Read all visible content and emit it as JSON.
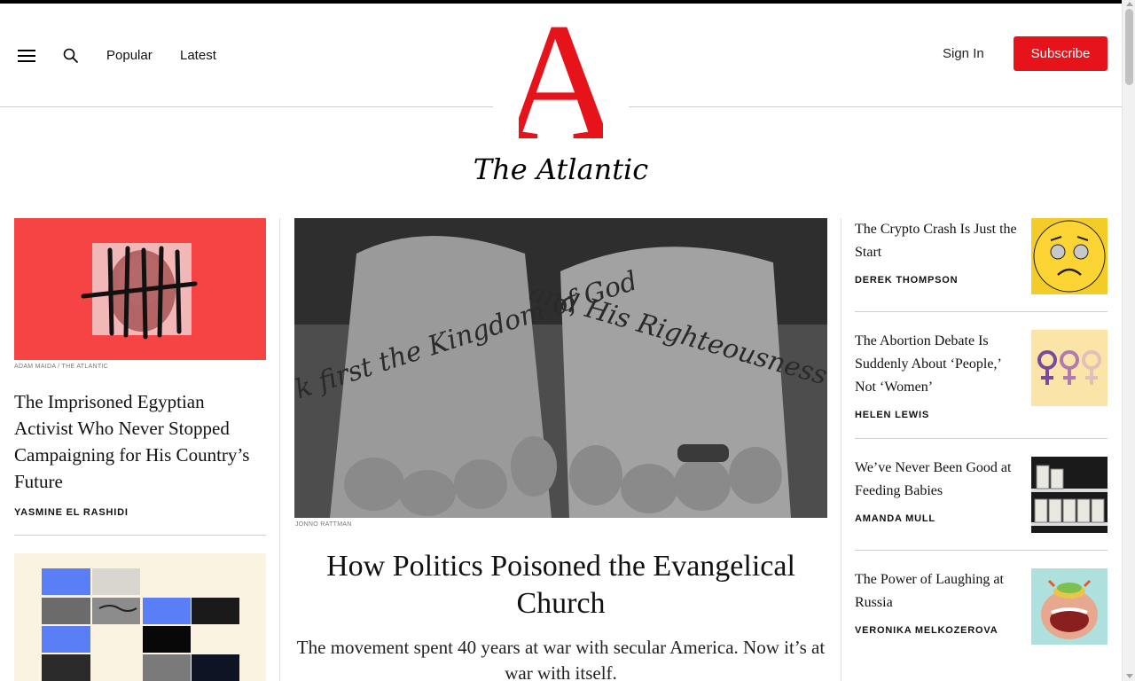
{
  "nav": {
    "popular": "Popular",
    "latest": "Latest",
    "sign_in": "Sign In",
    "subscribe": "Subscribe"
  },
  "brand": {
    "logo_letter": "A",
    "wordmark": "The Atlantic",
    "accent_color": "#e7131a"
  },
  "left": {
    "story1": {
      "credit": "ADAM MAIDA / THE ATLANTIC",
      "title": "The Imprisoned Egyptian Activist Who Never Stopped Campaigning for His Country’s Future",
      "byline": "YASMINE EL RASHIDI"
    }
  },
  "hero": {
    "credit": "JONNO RATTMAN",
    "title": "How Politics Poisoned the Evangelical Church",
    "dek": "The movement spent 40 years at war with secular America. Now it’s at war with itself.",
    "tattoo_left": "Seek first the Kingdom of God",
    "tattoo_right": "and His Righteousness"
  },
  "right": [
    {
      "title": "The Crypto Crash Is Just the Start",
      "byline": "DEREK THOMPSON",
      "icon": "worried-emoji-icon"
    },
    {
      "title": "The Abortion Debate Is Suddenly About ‘People,’ Not ‘Women’",
      "byline": "HELEN LEWIS",
      "icon": "female-symbols-icon"
    },
    {
      "title": "We’ve Never Been Good at Feeding Babies",
      "byline": "AMANDA MULL",
      "icon": "formula-shelf-icon"
    },
    {
      "title": "The Power of Laughing at Russia",
      "byline": "VERONIKA MELKOZEROVA",
      "icon": "laughing-face-icon"
    }
  ]
}
